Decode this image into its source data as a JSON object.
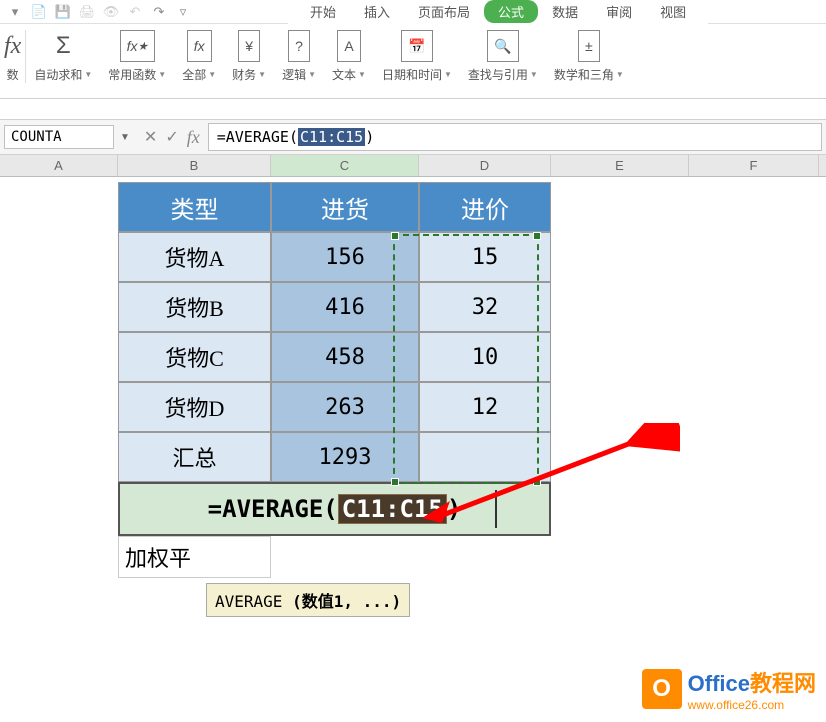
{
  "quick_access": {
    "icons": [
      "save-as-icon",
      "save-icon",
      "print-icon",
      "preview-icon",
      "undo-icon",
      "redo-icon"
    ]
  },
  "tabs": {
    "items": [
      {
        "label": "开始"
      },
      {
        "label": "插入"
      },
      {
        "label": "页面布局"
      },
      {
        "label": "公式",
        "active": true
      },
      {
        "label": "数据"
      },
      {
        "label": "审阅"
      },
      {
        "label": "视图"
      }
    ]
  },
  "ribbon": {
    "groups": [
      {
        "label": "数",
        "icon": "fx-icon",
        "dropless": true
      },
      {
        "label": "自动求和",
        "icon": "sigma-icon"
      },
      {
        "label": "常用函数",
        "icon": "fx-star-icon"
      },
      {
        "label": "全部",
        "icon": "fx-box-icon"
      },
      {
        "label": "财务",
        "icon": "money-icon"
      },
      {
        "label": "逻辑",
        "icon": "logic-icon"
      },
      {
        "label": "文本",
        "icon": "text-icon"
      },
      {
        "label": "日期和时间",
        "icon": "calendar-icon"
      },
      {
        "label": "查找与引用",
        "icon": "search-icon"
      },
      {
        "label": "数学和三角",
        "icon": "math-icon"
      }
    ]
  },
  "name_box": "COUNTA",
  "formula_bar": {
    "prefix": "=AVERAGE(",
    "selection": "C11:C15",
    "suffix": ")"
  },
  "columns": [
    "A",
    "B",
    "C",
    "D",
    "E",
    "F"
  ],
  "table": {
    "header": [
      "类型",
      "进货",
      "进价"
    ],
    "rows": [
      [
        "货物A",
        "156",
        "15"
      ],
      [
        "货物B",
        "416",
        "32"
      ],
      [
        "货物C",
        "458",
        "10"
      ],
      [
        "货物D",
        "263",
        "12"
      ],
      [
        "汇总",
        "1293",
        ""
      ]
    ]
  },
  "active_formula": {
    "prefix": "=AVERAGE(",
    "ref": "C11:C15",
    "suffix": ")"
  },
  "bottom_label": "加权平",
  "tooltip": {
    "fn": "AVERAGE",
    "args": "(数值1, ...)"
  },
  "watermark": {
    "brand_blue": "Office",
    "brand_orange": "教程网",
    "url": "www.office26.com"
  }
}
